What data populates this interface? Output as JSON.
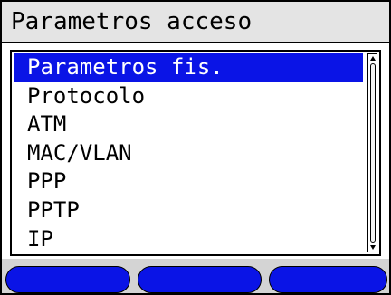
{
  "header": {
    "title": "Parametros acceso"
  },
  "menu": {
    "selected_index": 0,
    "items": [
      {
        "label": "Parametros fis."
      },
      {
        "label": "Protocolo"
      },
      {
        "label": "ATM"
      },
      {
        "label": "MAC/VLAN"
      },
      {
        "label": "PPP"
      },
      {
        "label": "PPTP"
      },
      {
        "label": "IP"
      }
    ]
  },
  "softkeys": [
    {
      "label": ""
    },
    {
      "label": ""
    },
    {
      "label": ""
    }
  ],
  "colors": {
    "selection": "#0a14e6",
    "softkey": "#0a14e6",
    "title_bar": "#e4e4e4",
    "softkey_bar": "#d4d4d4"
  }
}
